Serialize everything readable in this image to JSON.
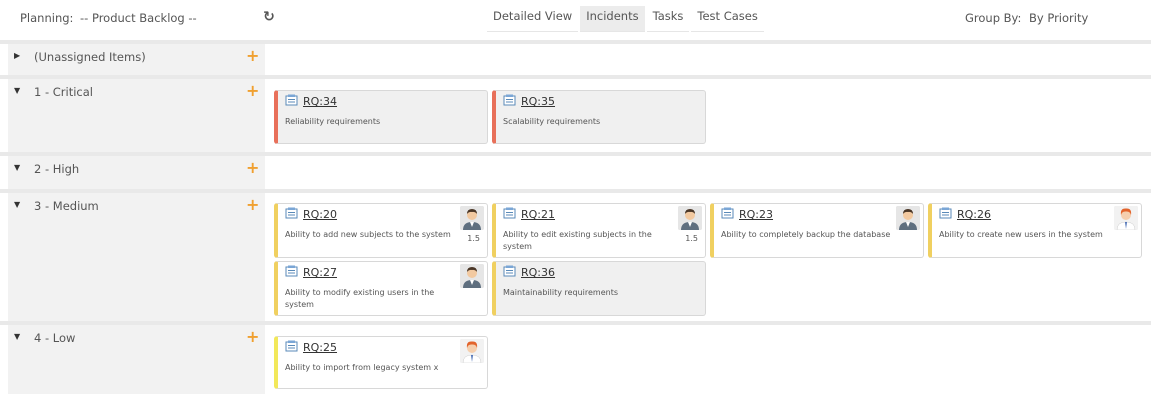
{
  "toolbar": {
    "planning_label": "Planning:",
    "planning_value": "-- Product Backlog --",
    "refresh_icon": "refresh-icon",
    "tabs": [
      {
        "label": "Detailed View",
        "active": false
      },
      {
        "label": "Incidents",
        "active": true
      },
      {
        "label": "Tasks",
        "active": false
      },
      {
        "label": "Test Cases",
        "active": false
      }
    ],
    "groupby_label": "Group By:",
    "groupby_value": "By Priority"
  },
  "colors": {
    "critical": "#e8705a",
    "medium": "#f0d060",
    "low": "#f2e85a",
    "add": "#f0a030",
    "header_bg": "#f2f2f2"
  },
  "groups": [
    {
      "label": "(Unassigned Items)",
      "expanded": false,
      "cards": []
    },
    {
      "label": "1 - Critical",
      "expanded": true,
      "cards": [
        {
          "id": "RQ:34",
          "desc": "Reliability requirements"
        },
        {
          "id": "RQ:35",
          "desc": "Scalability requirements"
        }
      ]
    },
    {
      "label": "2 - High",
      "expanded": true,
      "cards": []
    },
    {
      "label": "3 - Medium",
      "expanded": true,
      "cards": [
        {
          "id": "RQ:20",
          "desc": "Ability to add new subjects to the system",
          "estimate": "1.5",
          "avatar": "male-avatar"
        },
        {
          "id": "RQ:21",
          "desc": "Ability to edit existing subjects in the system",
          "estimate": "1.5",
          "avatar": "male-avatar"
        },
        {
          "id": "RQ:23",
          "desc": "Ability to completely backup the database",
          "avatar": "male-avatar"
        },
        {
          "id": "RQ:26",
          "desc": "Ability to create new users in the system",
          "avatar": "redhead-avatar"
        },
        {
          "id": "RQ:27",
          "desc": "Ability to modify existing users in the system",
          "avatar": "male-avatar"
        },
        {
          "id": "RQ:36",
          "desc": "Maintainability requirements"
        }
      ]
    },
    {
      "label": "4 - Low",
      "expanded": true,
      "cards": [
        {
          "id": "RQ:25",
          "desc": "Ability to import from legacy system x",
          "avatar": "redhead-avatar"
        }
      ]
    }
  ]
}
